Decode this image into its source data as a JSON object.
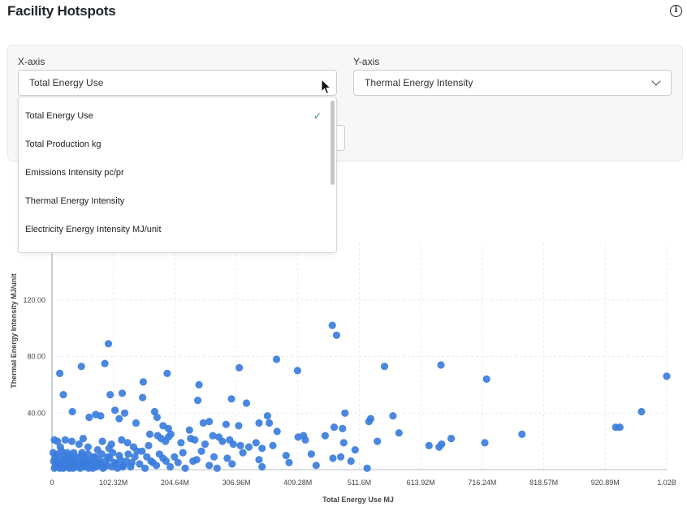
{
  "header": {
    "title": "Facility Hotspots",
    "info_icon": "info-icon"
  },
  "controls": {
    "x_axis": {
      "label": "X-axis",
      "value": "Total Energy Use",
      "state": "open"
    },
    "y_axis": {
      "label": "Y-axis",
      "value": "Thermal Energy Intensity"
    }
  },
  "dropdown": {
    "selected_index": 0,
    "options": [
      "Total Energy Use",
      "Total Production kg",
      "Emissions Intensity pc/pr",
      "Thermal Energy Intensity",
      "Electricity Energy Intensity MJ/unit"
    ]
  },
  "chart_data": {
    "type": "scatter",
    "xlabel": "Total Energy Use MJ",
    "ylabel": "Thermal Energy Intensity MJ/unit",
    "xlim": [
      0,
      1024000000
    ],
    "ylim": [
      0,
      160
    ],
    "x_ticks": [
      "0",
      "102.32M",
      "204.64M",
      "306.96M",
      "409.28M",
      "511.6M",
      "613.92M",
      "716.24M",
      "818.57M",
      "920.89M",
      "1.02B"
    ],
    "y_ticks": [
      {
        "value": 40,
        "label": "40.00"
      },
      {
        "value": 80,
        "label": "80.00"
      },
      {
        "value": 120,
        "label": "120.00"
      }
    ],
    "point_color": "#3b7ddd",
    "grid": true,
    "points": [
      [
        13000000.0,
        68
      ],
      [
        19000000.0,
        53
      ],
      [
        49000000.0,
        73
      ],
      [
        88000000.0,
        75
      ],
      [
        94000000.0,
        89
      ],
      [
        97000000.0,
        53
      ],
      [
        117000000.0,
        54
      ],
      [
        152000000.0,
        62
      ],
      [
        192000000.0,
        68
      ],
      [
        245000000.0,
        60
      ],
      [
        312000000.0,
        72
      ],
      [
        374000000.0,
        78
      ],
      [
        409000000.0,
        70
      ],
      [
        467000000.0,
        102
      ],
      [
        474000000.0,
        95
      ],
      [
        554000000.0,
        73
      ],
      [
        648000000.0,
        74
      ],
      [
        724000000.0,
        64
      ],
      [
        1024000000.0,
        66
      ],
      [
        34000000.0,
        41
      ],
      [
        73000000.0,
        39
      ],
      [
        81000000.0,
        38
      ],
      [
        62000000.0,
        37
      ],
      [
        105000000.0,
        42
      ],
      [
        121000000.0,
        40
      ],
      [
        151000000.0,
        51
      ],
      [
        171000000.0,
        41
      ],
      [
        175000000.0,
        37
      ],
      [
        243000000.0,
        49
      ],
      [
        299000000.0,
        50
      ],
      [
        324000000.0,
        47
      ],
      [
        359000000.0,
        38
      ],
      [
        362000000.0,
        33
      ],
      [
        345000000.0,
        33
      ],
      [
        311000000.0,
        31
      ],
      [
        290000000.0,
        32
      ],
      [
        262000000.0,
        34
      ],
      [
        252000000.0,
        33
      ],
      [
        229000000.0,
        28
      ],
      [
        194000000.0,
        29
      ],
      [
        185000000.0,
        31
      ],
      [
        140000000.0,
        33
      ],
      [
        112000000.0,
        36
      ],
      [
        488000000.0,
        40
      ],
      [
        470000000.0,
        30
      ],
      [
        484000000.0,
        29
      ],
      [
        528000000.0,
        34
      ],
      [
        531000000.0,
        36
      ],
      [
        568000000.0,
        38
      ],
      [
        578000000.0,
        26
      ],
      [
        542000000.0,
        20
      ],
      [
        375000000.0,
        27
      ],
      [
        410000000.0,
        23
      ],
      [
        419000000.0,
        24
      ],
      [
        422000000.0,
        21
      ],
      [
        455000000.0,
        24
      ],
      [
        486000000.0,
        19
      ],
      [
        628000000.0,
        17
      ],
      [
        645000000.0,
        16
      ],
      [
        649000000.0,
        18
      ],
      [
        665000000.0,
        22
      ],
      [
        721000000.0,
        19
      ],
      [
        783000000.0,
        25
      ],
      [
        939000000.0,
        30
      ],
      [
        946000000.0,
        30
      ],
      [
        982000000.0,
        41
      ],
      [
        4000000.0,
        21
      ],
      [
        9000000.0,
        20
      ],
      [
        14000000.0,
        16
      ],
      [
        22000000.0,
        21
      ],
      [
        33000000.0,
        20
      ],
      [
        45000000.0,
        18
      ],
      [
        52000000.0,
        22
      ],
      [
        60000000.0,
        16
      ],
      [
        76000000.0,
        14
      ],
      [
        84000000.0,
        20
      ],
      [
        95000000.0,
        15
      ],
      [
        99000000.0,
        18
      ],
      [
        116000000.0,
        21
      ],
      [
        126000000.0,
        19
      ],
      [
        136000000.0,
        16
      ],
      [
        150000000.0,
        13
      ],
      [
        161000000.0,
        17
      ],
      [
        163000000.0,
        25
      ],
      [
        176000000.0,
        24
      ],
      [
        182000000.0,
        22
      ],
      [
        189000000.0,
        20
      ],
      [
        194000000.0,
        23
      ],
      [
        198000000.0,
        25
      ],
      [
        215000000.0,
        19
      ],
      [
        231000000.0,
        22
      ],
      [
        238000000.0,
        21
      ],
      [
        255000000.0,
        18
      ],
      [
        268000000.0,
        24
      ],
      [
        278000000.0,
        23
      ],
      [
        284000000.0,
        20
      ],
      [
        296000000.0,
        21
      ],
      [
        302000000.0,
        18
      ],
      [
        314000000.0,
        17
      ],
      [
        328000000.0,
        16
      ],
      [
        340000000.0,
        19
      ],
      [
        350000000.0,
        15
      ],
      [
        368000000.0,
        17
      ],
      [
        3000000.0,
        6
      ],
      [
        6000000.0,
        4
      ],
      [
        8000000.0,
        8
      ],
      [
        10000000.0,
        3
      ],
      [
        12000000.0,
        5
      ],
      [
        15000000.0,
        2
      ],
      [
        17000000.0,
        7
      ],
      [
        19000000.0,
        1
      ],
      [
        21000000.0,
        4
      ],
      [
        24000000.0,
        6
      ],
      [
        26000000.0,
        2
      ],
      [
        28000000.0,
        9
      ],
      [
        30000000.0,
        3
      ],
      [
        32000000.0,
        5
      ],
      [
        35000000.0,
        1
      ],
      [
        37000000.0,
        7
      ],
      [
        39000000.0,
        4
      ],
      [
        42000000.0,
        2
      ],
      [
        44000000.0,
        6
      ],
      [
        46000000.0,
        3
      ],
      [
        49000000.0,
        10
      ],
      [
        51000000.0,
        5
      ],
      [
        54000000.0,
        2
      ],
      [
        56000000.0,
        8
      ],
      [
        58000000.0,
        4
      ],
      [
        61000000.0,
        1
      ],
      [
        63000000.0,
        6
      ],
      [
        66000000.0,
        3
      ],
      [
        69000000.0,
        9
      ],
      [
        71000000.0,
        5
      ],
      [
        74000000.0,
        2
      ],
      [
        78000000.0,
        7
      ],
      [
        81000000.0,
        4
      ],
      [
        85000000.0,
        1
      ],
      [
        89000000.0,
        6
      ],
      [
        92000000.0,
        3
      ],
      [
        96000000.0,
        8
      ],
      [
        100000000.0,
        2
      ],
      [
        104000000.0,
        5
      ],
      [
        109000000.0,
        1
      ],
      [
        114000000.0,
        7
      ],
      [
        119000000.0,
        3
      ],
      [
        124000000.0,
        6
      ],
      [
        131000000.0,
        2
      ],
      [
        138000000.0,
        9
      ],
      [
        146000000.0,
        4
      ],
      [
        155000000.0,
        1
      ],
      [
        165000000.0,
        6
      ],
      [
        174000000.0,
        3
      ],
      [
        185000000.0,
        8
      ],
      [
        197000000.0,
        2
      ],
      [
        210000000.0,
        5
      ],
      [
        222000000.0,
        1
      ],
      [
        241000000.0,
        7
      ],
      [
        262000000.0,
        3
      ],
      [
        275000000.0,
        1
      ],
      [
        300000000.0,
        4
      ],
      [
        350000000.0,
        2
      ],
      [
        395000000.0,
        5
      ],
      [
        440000000.0,
        3
      ],
      [
        468000000.0,
        8
      ],
      [
        498000000.0,
        6
      ],
      [
        525000000.0,
        1
      ],
      [
        2000000.0,
        12
      ],
      [
        4000000.0,
        1
      ],
      [
        5000000.0,
        9
      ],
      [
        7000000.0,
        2
      ],
      [
        9000000.0,
        11
      ],
      [
        11000000.0,
        6
      ],
      [
        13000000.0,
        1
      ],
      [
        16000000.0,
        13
      ],
      [
        18000000.0,
        5
      ],
      [
        20000000.0,
        10
      ],
      [
        23000000.0,
        3
      ],
      [
        25000000.0,
        12
      ],
      [
        27000000.0,
        8
      ],
      [
        29000000.0,
        1
      ],
      [
        31000000.0,
        10
      ],
      [
        34000000.0,
        6
      ],
      [
        36000000.0,
        12
      ],
      [
        38000000.0,
        2
      ],
      [
        40000000.0,
        9
      ],
      [
        43000000.0,
        5
      ],
      [
        47000000.0,
        1
      ],
      [
        50000000.0,
        12
      ],
      [
        53000000.0,
        7
      ],
      [
        57000000.0,
        3
      ],
      [
        60000000.0,
        11
      ],
      [
        65000000.0,
        5
      ],
      [
        68000000.0,
        1
      ],
      [
        72000000.0,
        9
      ],
      [
        77000000.0,
        4
      ],
      [
        83000000.0,
        11
      ],
      [
        87000000.0,
        2
      ],
      [
        93000000.0,
        9
      ],
      [
        101000000.0,
        12
      ],
      [
        107000000.0,
        4
      ],
      [
        112000000.0,
        10
      ],
      [
        118000000.0,
        2
      ],
      [
        127000000.0,
        11
      ],
      [
        133000000.0,
        5
      ],
      [
        142000000.0,
        13
      ],
      [
        158000000.0,
        9
      ],
      [
        168000000.0,
        5
      ],
      [
        179000000.0,
        11
      ],
      [
        190000000.0,
        6
      ],
      [
        204000000.0,
        9
      ],
      [
        218000000.0,
        12
      ],
      [
        235000000.0,
        6
      ],
      [
        249000000.0,
        13
      ],
      [
        270000000.0,
        9
      ],
      [
        292000000.0,
        8
      ],
      [
        318000000.0,
        12
      ],
      [
        345000000.0,
        7
      ],
      [
        390000000.0,
        10
      ],
      [
        432000000.0,
        11
      ],
      [
        481000000.0,
        9
      ],
      [
        505000000.0,
        14
      ]
    ]
  }
}
